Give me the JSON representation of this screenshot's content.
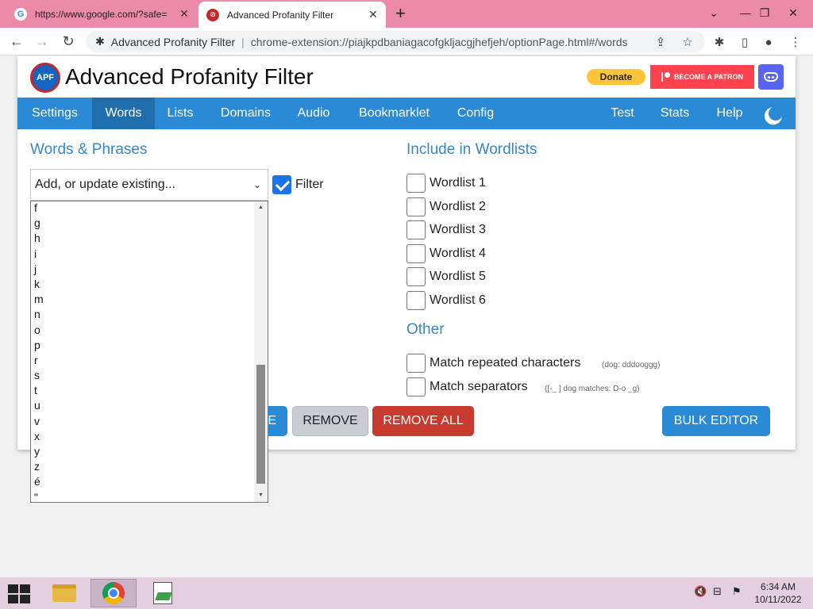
{
  "browser": {
    "tabs": [
      {
        "title": "https://www.google.com/?safe=",
        "favicon": "G"
      },
      {
        "title": "Advanced Profanity Filter",
        "favicon": "APF"
      }
    ],
    "new_tab": "+",
    "omnibox": {
      "site": "Advanced Profanity Filter",
      "url": "chrome-extension://piajkpdbaniagacofgkljacgjhefjeh/optionPage.html#/words"
    }
  },
  "app": {
    "title": "Advanced Profanity Filter",
    "logo_text": "APF",
    "donate_label": "Donate",
    "patron_label": "BECOME A PATRON"
  },
  "nav": {
    "items": [
      "Settings",
      "Words",
      "Lists",
      "Domains",
      "Audio",
      "Bookmarklet",
      "Config"
    ],
    "right_items": [
      "Test",
      "Stats",
      "Help"
    ],
    "active": "Words"
  },
  "words": {
    "heading": "Words & Phrases",
    "select_value": "Add, or update existing...",
    "filter_label": "Filter",
    "filter_checked": true,
    "dropdown_options": [
      "f",
      "g",
      "h",
      "i",
      "j",
      "k",
      "m",
      "n",
      "o",
      "p",
      "r",
      "s",
      "t",
      "u",
      "v",
      "x",
      "y",
      "z",
      "é",
      "\""
    ]
  },
  "wordlists": {
    "heading": "Include in Wordlists",
    "items": [
      "Wordlist 1",
      "Wordlist 2",
      "Wordlist 3",
      "Wordlist 4",
      "Wordlist 5",
      "Wordlist 6"
    ]
  },
  "other": {
    "heading": "Other",
    "repeated_label": "Match repeated characters",
    "repeated_hint": "(dog: dddooggg)",
    "separators_label": "Match separators",
    "separators_hint": "([-_ ] dog matches: D-o _g)"
  },
  "buttons": {
    "save_partial": "E",
    "remove": "REMOVE",
    "remove_all": "REMOVE ALL",
    "bulk_editor": "BULK EDITOR"
  },
  "taskbar": {
    "time": "6:34 AM",
    "date": "10/11/2022"
  },
  "colors": {
    "nav_blue": "#2a8ad6",
    "heading_blue": "#3a86c4",
    "danger_red": "#c8392e",
    "tab_strip_pink": "#ec8aaa"
  }
}
